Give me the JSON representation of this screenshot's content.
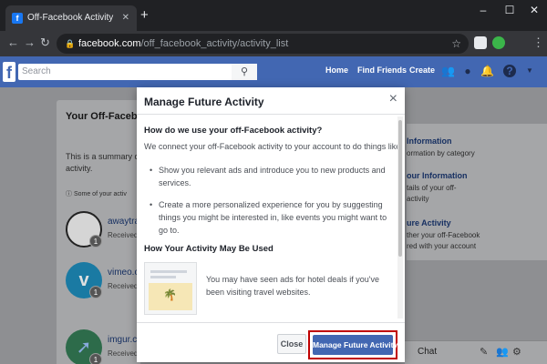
{
  "browser": {
    "tab_title": "Off-Facebook Activity",
    "tab_favicon": "f",
    "url_host": "facebook.com",
    "url_path": "/off_facebook_activity/activity_list",
    "new_tab": "+",
    "tab_close": "✕",
    "win_min": "–",
    "win_max": "☐",
    "win_close": "✕"
  },
  "fb_header": {
    "logo": "f",
    "search_placeholder": "Search",
    "nav": [
      "Home",
      "Find Friends",
      "Create"
    ]
  },
  "left_card": {
    "title": "Your Off-Facebo",
    "summary_line1": "This is a summary of",
    "summary_line2": "activity.",
    "note": "Some of your activ",
    "sites": [
      {
        "name": "awaytra",
        "received": "Received",
        "count": "1"
      },
      {
        "name": "vimeo.c",
        "received": "Received",
        "count": "1"
      },
      {
        "name": "imgur.c",
        "received": "Received",
        "count": "1"
      }
    ]
  },
  "right_card": {
    "h1": "Information",
    "t1": "ormation by category",
    "h2": "our Information",
    "t2a": "tails of your off-",
    "t2b": "activity",
    "h3": "ure Activity",
    "t3a": "ther your off-Facebook",
    "t3b": "red with your account"
  },
  "chat": {
    "label": "Chat"
  },
  "modal": {
    "title": "Manage Future Activity",
    "close_x": "×",
    "question": "How do we use your off-Facebook activity?",
    "intro": "We connect your off-Facebook activity to your account to do things like:",
    "bullets": [
      "Show you relevant ads and introduce you to new products and services.",
      "Create a more personalized experience for you by suggesting things you might be interested in, like events you might want to go to."
    ],
    "how_title": "How Your Activity May Be Used",
    "how_text": "You may have seen ads for hotel deals if you've been visiting travel websites.",
    "close_button": "Close",
    "manage_button": "Manage Future Activity"
  },
  "colors": {
    "fb_blue": "#4267b2",
    "highlight": "#c00000"
  }
}
